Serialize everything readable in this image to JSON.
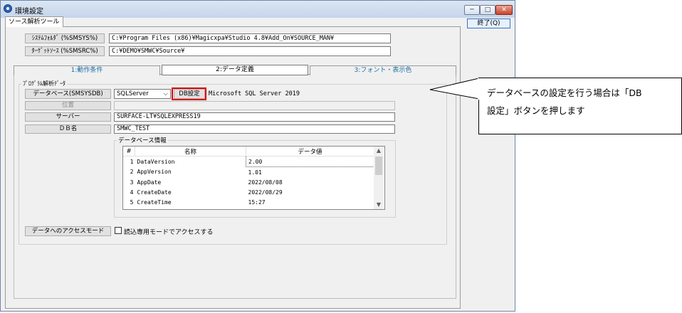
{
  "window": {
    "title": "環境設定",
    "minimize_glyph": "─",
    "maximize_glyph": "□",
    "close_glyph": "✕",
    "outer_tab": "ソース解析ツール",
    "exit_button": "終了(Q)"
  },
  "paths": {
    "system_folder_label": "ｼｽﾃﾑﾌｫﾙﾀﾞ (%SMSYS%)",
    "system_folder_value": "C:¥Program Files (x86)¥Magicxpa¥Studio 4.8¥Add_On¥SOURCE_MAN¥",
    "target_source_label": "ﾀｰｹﾞｯﾄｿｰｽ (%SMSRC%)",
    "target_source_value": "C:¥DEMO¥SMWC¥Source¥"
  },
  "tabs": [
    {
      "label": "1:動作条件"
    },
    {
      "label": "2:データ定義"
    },
    {
      "label": "3:フォント・表示色"
    }
  ],
  "program_group": {
    "label": "ﾌﾟﾛｸﾞﾗﾑ解析ﾃﾞｰﾀ",
    "database_button": "データベース(SMSYSDB)",
    "database_select": "SQLServer",
    "database_select_arrow": "⌵",
    "db_setting_button": "DB設定",
    "db_product": "Microsoft SQL Server 2019",
    "location_button": "位置",
    "location_value": "",
    "server_button": "サーバー",
    "server_value": "SURFACE-LT¥SQLEXPRESS19",
    "dbname_button": "ＤＢ名",
    "dbname_value": "SMWC_TEST",
    "dbinfo_label": "データベース情報",
    "table_headers": [
      "#",
      "名称",
      "データ値"
    ],
    "table_rows": [
      {
        "no": "1",
        "name": "DataVersion",
        "value": "2.00"
      },
      {
        "no": "2",
        "name": "AppVersion",
        "value": "1.01"
      },
      {
        "no": "3",
        "name": "AppDate",
        "value": "2022/08/08"
      },
      {
        "no": "4",
        "name": "CreateDate",
        "value": "2022/08/29"
      },
      {
        "no": "5",
        "name": "CreateTime",
        "value": "15:27"
      }
    ],
    "access_mode_button": "データへのアクセスモード",
    "readonly_checkbox_label": "読込専用モードでアクセスする"
  },
  "callout": {
    "line1": "データベースの設定を行う場合は「DB",
    "line2": "設定」ボタンを押します"
  },
  "colors": {
    "highlight": "#e00000",
    "tab_text": "#1a6fa8"
  }
}
